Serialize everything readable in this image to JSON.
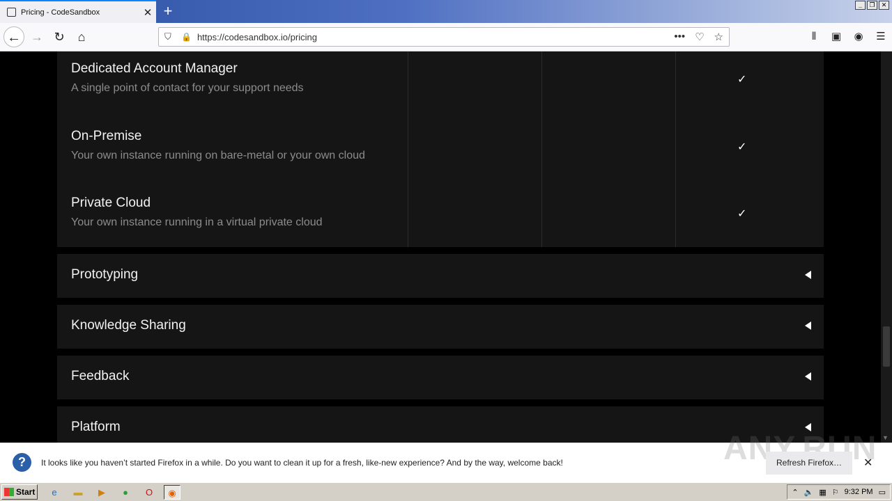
{
  "browser": {
    "tab_title": "Pricing - CodeSandbox",
    "url": "https://codesandbox.io/pricing"
  },
  "features": [
    {
      "name": "Dedicated Account Manager",
      "description": "A single point of contact for your support needs",
      "check": "✓"
    },
    {
      "name": "On-Premise",
      "description": "Your own instance running on bare-metal or your own cloud",
      "check": "✓"
    },
    {
      "name": "Private Cloud",
      "description": "Your own instance running in a virtual private cloud",
      "check": "✓"
    }
  ],
  "sections": [
    "Prototyping",
    "Knowledge Sharing",
    "Feedback",
    "Platform"
  ],
  "notification": {
    "message": "It looks like you haven’t started Firefox in a while. Do you want to clean it up for a fresh, like-new experience? And by the way, welcome back!",
    "button": "Refresh Firefox…",
    "watermark": "ANY.RUN"
  },
  "taskbar": {
    "start_label": "Start",
    "clock": "9:32 PM"
  }
}
